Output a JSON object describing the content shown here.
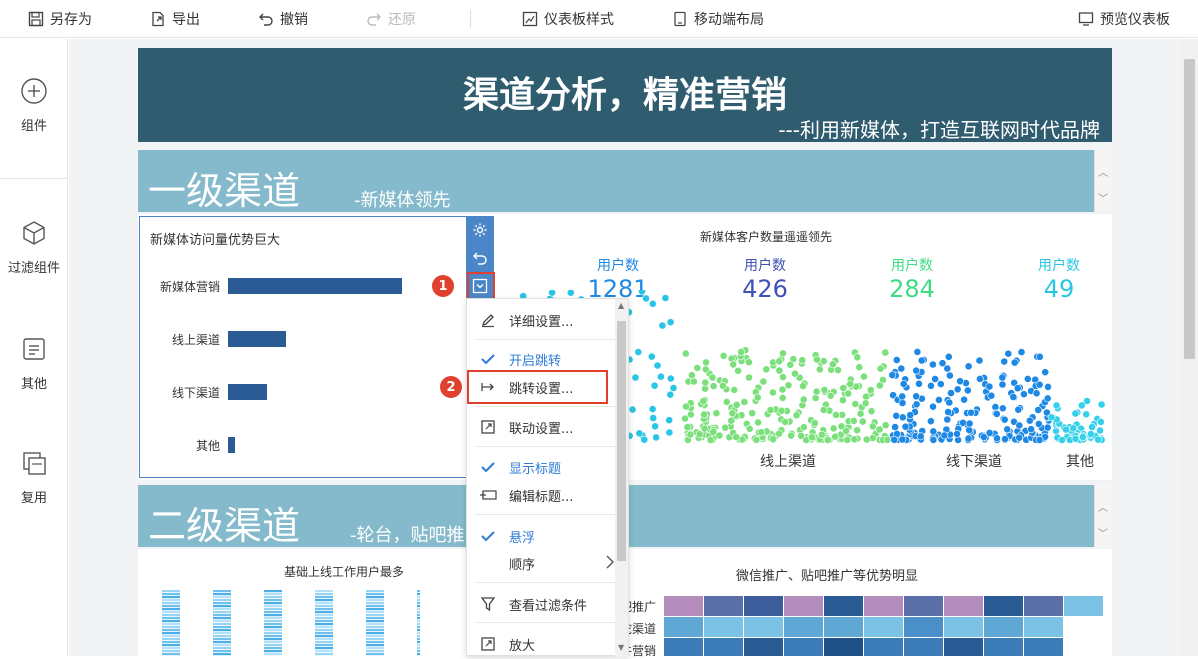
{
  "toolbar": {
    "save_as": "另存为",
    "export": "导出",
    "undo": "撤销",
    "redo": "还原",
    "dashboard_style": "仪表板样式",
    "mobile_layout": "移动端布局",
    "preview": "预览仪表板"
  },
  "sidebar": {
    "items": [
      {
        "label": "组件",
        "icon": "plus-circle-icon"
      },
      {
        "label": "过滤组件",
        "icon": "cube-icon"
      },
      {
        "label": "其他",
        "icon": "document-icon"
      },
      {
        "label": "复用",
        "icon": "copy-icon"
      }
    ]
  },
  "banner": {
    "title": "渠道分析，精准营销",
    "subtitle": "---利用新媒体，打造互联网时代品牌"
  },
  "section1": {
    "title": "一级渠道",
    "subtitle": "-新媒体领先"
  },
  "section2": {
    "title": "二级渠道",
    "subtitle": "-轮台，贴吧推"
  },
  "widget_bar": {
    "title": "新媒体访问量优势巨大",
    "chart_data": {
      "type": "bar",
      "categories": [
        "新媒体营销",
        "线上渠道",
        "线下渠道",
        "其他"
      ],
      "values": [
        1281,
        426,
        284,
        49
      ]
    }
  },
  "widget_scatter": {
    "title": "新媒体客户数量遥遥领先",
    "stats": [
      {
        "key": "用户数",
        "value": "1281",
        "color": "#1e88e5"
      },
      {
        "key": "用户数",
        "value": "426",
        "color": "#3f51b5"
      },
      {
        "key": "用户数",
        "value": "284",
        "color": "#3ddc84"
      },
      {
        "key": "用户数",
        "value": "49",
        "color": "#29c5e6"
      }
    ],
    "axis_labels": [
      "线上渠道",
      "线下渠道",
      "其他"
    ]
  },
  "bottom": {
    "left_title": "基础上线工作用户最多",
    "right_title": "微信推广、贴吧推广等优势明显",
    "heatmap_rows": [
      "吧推广",
      "陀渠道",
      "牛营销"
    ]
  },
  "widget_tools": {
    "settings": "gear-icon",
    "back": "undo-icon",
    "more": "dropdown-icon"
  },
  "context_menu": {
    "items": [
      {
        "label": "详细设置...",
        "icon": "edit-icon",
        "checked": false
      },
      {
        "label": "开启跳转",
        "icon": "check-icon",
        "checked": true
      },
      {
        "label": "跳转设置...",
        "icon": "jump-icon",
        "checked": false
      },
      {
        "label": "联动设置...",
        "icon": "link-icon",
        "checked": false
      },
      {
        "label": "显示标题",
        "icon": "check-icon",
        "checked": true
      },
      {
        "label": "编辑标题...",
        "icon": "title-edit-icon",
        "checked": false
      },
      {
        "label": "悬浮",
        "icon": "check-icon",
        "checked": true
      },
      {
        "label": "顺序",
        "icon": "",
        "checked": false
      },
      {
        "label": "查看过滤条件",
        "icon": "filter-icon",
        "checked": false
      },
      {
        "label": "放大",
        "icon": "zoom-icon",
        "checked": false
      }
    ]
  },
  "callouts": {
    "one": "1",
    "two": "2"
  }
}
